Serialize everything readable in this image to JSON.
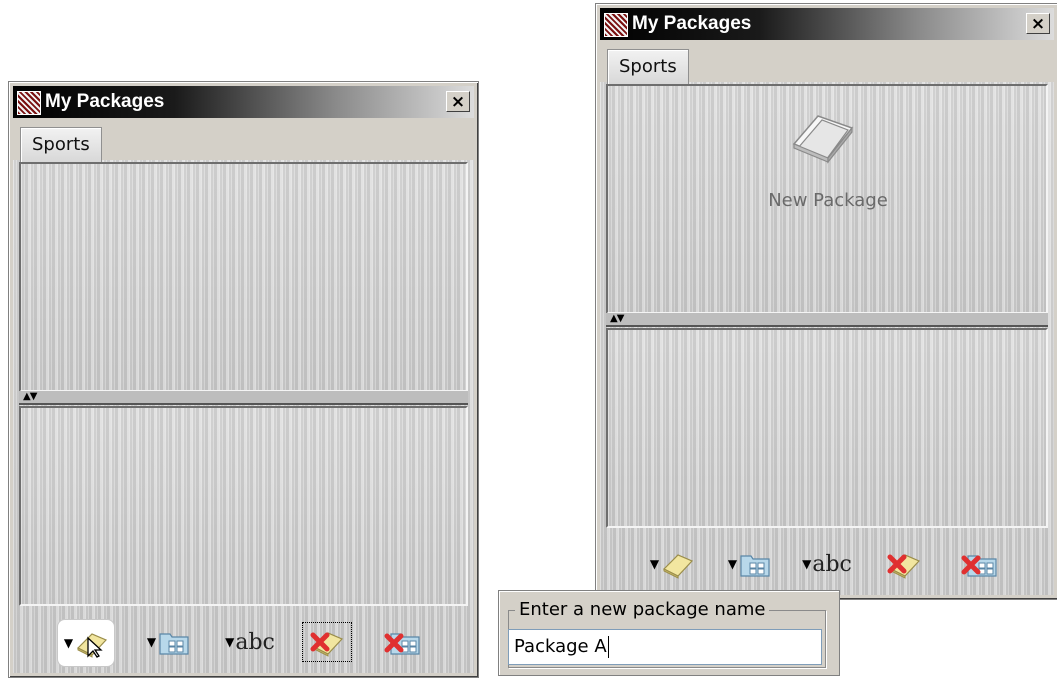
{
  "windows": [
    {
      "title": "My Packages",
      "close_label": "×",
      "tab_label": "Sports",
      "upper_pane_items": [],
      "toolbar": {
        "new_package_icon": "new-package-icon",
        "new_folder_icon": "new-folder-icon",
        "rename_icon": "rename-icon",
        "rename_label": "abc",
        "delete_package_icon": "delete-package-icon",
        "delete_folder_icon": "delete-folder-icon"
      }
    },
    {
      "title": "My Packages",
      "close_label": "×",
      "tab_label": "Sports",
      "upper_pane_items": [
        {
          "label": "New Package",
          "icon": "package-icon"
        }
      ],
      "toolbar": {
        "rename_label": "abc"
      }
    }
  ],
  "name_dialog": {
    "group_label": "Enter a new package name",
    "input_value": "Package A"
  },
  "colors": {
    "window_bg": "#d4d0c8",
    "delete_red": "#e03030",
    "package_yellow": "#f2e6a0"
  }
}
